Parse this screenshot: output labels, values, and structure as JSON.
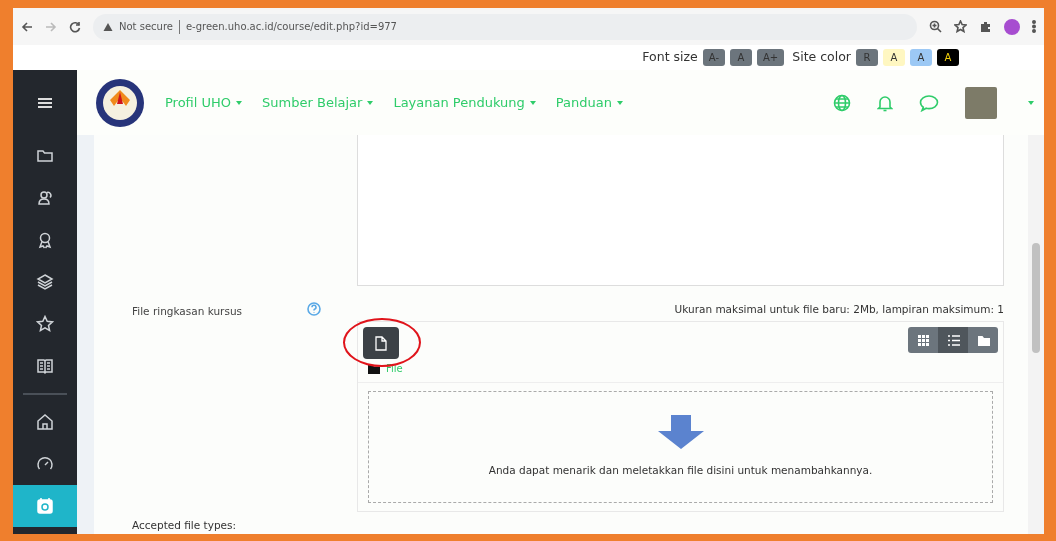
{
  "browser": {
    "warning": "Not secure",
    "url": "e-green.uho.ac.id/course/edit.php?id=977"
  },
  "accessibility": {
    "font_size_label": "Font size",
    "font_buttons": [
      "A-",
      "A",
      "A+"
    ],
    "site_color_label": "Site color",
    "color_buttons": [
      {
        "label": "R",
        "color": "#6c757d"
      },
      {
        "label": "A",
        "color": "#fff7c2"
      },
      {
        "label": "A",
        "color": "#9cc8f5"
      },
      {
        "label": "A",
        "color": "#000000"
      }
    ]
  },
  "sidebar": {
    "items": [
      {
        "kind": "folder",
        "selected": false
      },
      {
        "kind": "users",
        "selected": false
      },
      {
        "kind": "award",
        "selected": false
      },
      {
        "kind": "layers",
        "selected": false
      },
      {
        "kind": "star",
        "selected": false
      },
      {
        "kind": "book",
        "selected": false
      },
      {
        "kind": "divider"
      },
      {
        "kind": "home",
        "selected": false
      },
      {
        "kind": "gauge",
        "selected": false
      },
      {
        "kind": "calendar",
        "selected": true
      }
    ]
  },
  "navbar": {
    "menus": [
      "Profil UHO",
      "Sumber Belajar",
      "Layanan Pendukung",
      "Panduan"
    ]
  },
  "form": {
    "label": "File ringkasan kursus",
    "limits": "Ukuran maksimal untuk file baru: 2Mb, lampiran maksimum: 1",
    "views": [
      {
        "kind": "grid",
        "selected": false
      },
      {
        "kind": "list",
        "selected": true
      },
      {
        "kind": "tree",
        "selected": false
      }
    ],
    "path": "File",
    "drop_text": "Anda dapat menarik dan meletakkan file disini untuk menambahkannya.",
    "accepted": "Accepted file types:"
  }
}
